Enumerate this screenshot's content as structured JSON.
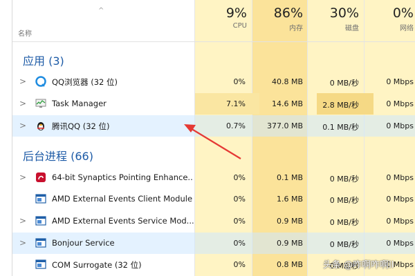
{
  "header": {
    "name_label": "名称",
    "columns": [
      {
        "key": "cpu",
        "percent": "9%",
        "label": "CPU"
      },
      {
        "key": "memory",
        "percent": "86%",
        "label": "内存"
      },
      {
        "key": "disk",
        "percent": "30%",
        "label": "磁盘"
      },
      {
        "key": "network",
        "percent": "0%",
        "label": "网络"
      }
    ]
  },
  "groups": {
    "apps": {
      "title": "应用 (3)",
      "rows": [
        {
          "name": "QQ浏览器 (32 位)",
          "icon": "qq-browser-icon",
          "cpu": "0%",
          "memory": "40.8 MB",
          "disk": "0 MB/秒",
          "network": "0 Mbps"
        },
        {
          "name": "Task Manager",
          "icon": "task-manager-icon",
          "cpu": "7.1%",
          "memory": "14.6 MB",
          "disk": "2.8 MB/秒",
          "network": "0 Mbps"
        },
        {
          "name": "腾讯QQ (32 位)",
          "icon": "qq-penguin-icon",
          "cpu": "0.7%",
          "memory": "377.0 MB",
          "disk": "0.1 MB/秒",
          "network": "0 Mbps"
        }
      ]
    },
    "background": {
      "title": "后台进程 (66)",
      "rows": [
        {
          "name": "64-bit Synaptics Pointing Enhance...",
          "icon": "synaptics-icon",
          "cpu": "0%",
          "memory": "0.1 MB",
          "disk": "0 MB/秒",
          "network": "0 Mbps"
        },
        {
          "name": "AMD External Events Client Module",
          "icon": "amd-service-icon",
          "cpu": "0%",
          "memory": "1.6 MB",
          "disk": "0 MB/秒",
          "network": "0 Mbps"
        },
        {
          "name": "AMD External Events Service Mod...",
          "icon": "amd-service-icon",
          "cpu": "0%",
          "memory": "0.9 MB",
          "disk": "0 MB/秒",
          "network": "0 Mbps"
        },
        {
          "name": "Bonjour Service",
          "icon": "bonjour-service-icon",
          "cpu": "0%",
          "memory": "0.9 MB",
          "disk": "0 MB/秒",
          "network": "0 Mbps"
        },
        {
          "name": "COM Surrogate (32 位)",
          "icon": "com-surrogate-icon",
          "cpu": "0%",
          "memory": "0.8 MB",
          "disk": "0 MB/秒",
          "network": "0 Mbps"
        }
      ]
    }
  },
  "colors": {
    "group_title": "#1c5aa6",
    "cpu_column_bg": "#fff4c4",
    "memory_column_bg": "#fbe39a",
    "disk_column_bg": "#fff4c4",
    "network_column_bg": "#fff4c4",
    "disk_high_highlight": "#f5d985",
    "arrow": "#e53935"
  },
  "watermark": "头条 @咋啊咋啊ll"
}
